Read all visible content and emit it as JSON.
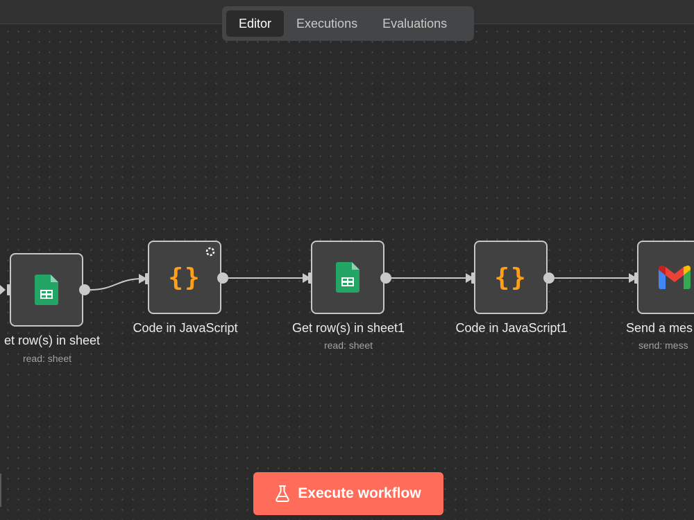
{
  "tabs": [
    {
      "label": "Editor",
      "active": true
    },
    {
      "label": "Executions",
      "active": false
    },
    {
      "label": "Evaluations",
      "active": false
    }
  ],
  "nodes": [
    {
      "id": "n1",
      "label": "et row(s) in sheet",
      "sub": "read: sheet",
      "icon": "google-sheets-icon"
    },
    {
      "id": "n2",
      "label": "Code in JavaScript",
      "sub": "",
      "icon": "code-braces-icon",
      "status_icon": "loading-spinner-icon"
    },
    {
      "id": "n3",
      "label": "Get row(s) in sheet1",
      "sub": "read: sheet",
      "icon": "google-sheets-icon"
    },
    {
      "id": "n4",
      "label": "Code in JavaScript1",
      "sub": "",
      "icon": "code-braces-icon"
    },
    {
      "id": "n5",
      "label": "Send a mes",
      "sub": "send: mess",
      "icon": "gmail-icon"
    }
  ],
  "execute_button": {
    "label": "Execute workflow",
    "icon": "flask-icon"
  },
  "colors": {
    "accent": "#ff6d5a",
    "sheets_green": "#22a565",
    "code_orange": "#ff9f1c",
    "canvas": "#2a2a2a"
  }
}
